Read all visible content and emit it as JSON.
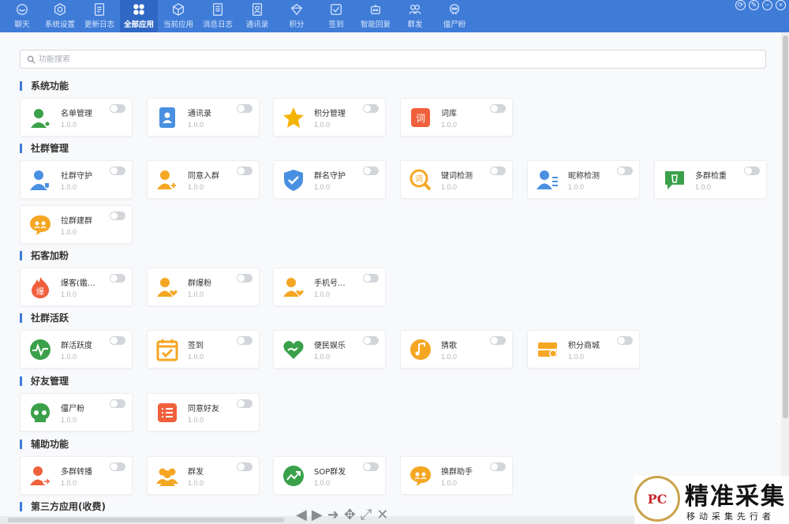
{
  "nav": {
    "tabs": [
      {
        "label": "聊天",
        "icon": "chat-icon"
      },
      {
        "label": "系统设置",
        "icon": "settings-icon"
      },
      {
        "label": "更新日志",
        "icon": "update-log-icon"
      },
      {
        "label": "全部应用",
        "icon": "all-apps-icon",
        "active": true
      },
      {
        "label": "当前应用",
        "icon": "current-apps-icon"
      },
      {
        "label": "消息日志",
        "icon": "message-log-icon"
      },
      {
        "label": "通讯录",
        "icon": "contacts-icon"
      },
      {
        "label": "积分",
        "icon": "points-icon"
      },
      {
        "label": "签到",
        "icon": "checkin-icon"
      },
      {
        "label": "智能回复",
        "icon": "robot-icon"
      },
      {
        "label": "群发",
        "icon": "broadcast-icon"
      },
      {
        "label": "僵尸粉",
        "icon": "zombie-icon"
      }
    ]
  },
  "search": {
    "placeholder": "功能搜索"
  },
  "sections": [
    {
      "title": "系统功能",
      "apps": [
        {
          "name": "名单管理",
          "version": "1.0.0",
          "icon": "user-list-icon",
          "color": "#3aa14a"
        },
        {
          "name": "通讯录",
          "version": "1.0.0",
          "icon": "contacts-book-icon",
          "color": "#4a90e2"
        },
        {
          "name": "积分管理",
          "version": "1.0.0",
          "icon": "star-icon",
          "color": "#f5b300"
        },
        {
          "name": "词库",
          "version": "1.0.0",
          "icon": "dictionary-icon",
          "color": "#f0603c"
        }
      ]
    },
    {
      "title": "社群管理",
      "apps": [
        {
          "name": "社群守护",
          "version": "1.0.0",
          "icon": "user-shield-icon",
          "color": "#4a90e2"
        },
        {
          "name": "同意入群",
          "version": "1.0.0",
          "icon": "group-add-icon",
          "color": "#f5a623"
        },
        {
          "name": "群名守护",
          "version": "1.0.0",
          "icon": "shield-icon",
          "color": "#4a90e2"
        },
        {
          "name": "键词检测",
          "version": "1.0.0",
          "icon": "keyword-search-icon",
          "color": "#f5a623"
        },
        {
          "name": "昵称检测",
          "version": "1.0.0",
          "icon": "user-list-check-icon",
          "color": "#4a90e2"
        },
        {
          "name": "多群检重",
          "version": "1.0.0",
          "icon": "trash-chat-icon",
          "color": "#3aa14a"
        },
        {
          "name": "拉群建群",
          "version": "1.0.0",
          "icon": "group-chat-icon",
          "color": "#f5a623"
        }
      ]
    },
    {
      "title": "拓客加粉",
      "apps": [
        {
          "name": "爆客(鑑...",
          "version": "1.0.0",
          "icon": "fire-icon",
          "color": "#f0603c"
        },
        {
          "name": "群爆粉",
          "version": "1.0.0",
          "icon": "user-heart-icon",
          "color": "#f5a623"
        },
        {
          "name": "手机号...",
          "version": "1.0.0",
          "icon": "user-heart-icon",
          "color": "#f5a623"
        }
      ]
    },
    {
      "title": "社群活跃",
      "apps": [
        {
          "name": "群活跃度",
          "version": "1.0.0",
          "icon": "activity-icon",
          "color": "#3aa14a"
        },
        {
          "name": "签到",
          "version": "1.0.0",
          "icon": "calendar-check-icon",
          "color": "#f5a623"
        },
        {
          "name": "便民娱乐",
          "version": "1.0.0",
          "icon": "heart-hand-icon",
          "color": "#3aa14a"
        },
        {
          "name": "猜歌",
          "version": "1.0.0",
          "icon": "music-icon",
          "color": "#f5a623"
        },
        {
          "name": "积分商城",
          "version": "1.0.0",
          "icon": "coins-icon",
          "color": "#f5a623"
        }
      ]
    },
    {
      "title": "好友管理",
      "apps": [
        {
          "name": "僵尸粉",
          "version": "1.0.0",
          "icon": "skull-icon",
          "color": "#3aa14a"
        },
        {
          "name": "同意好友",
          "version": "1.0.0",
          "icon": "checklist-icon",
          "color": "#f0603c"
        }
      ]
    },
    {
      "title": "辅助功能",
      "apps": [
        {
          "name": "多群转播",
          "version": "1.0.0",
          "icon": "user-share-icon",
          "color": "#f0603c"
        },
        {
          "name": "群发",
          "version": "1.0.0",
          "icon": "group-users-icon",
          "color": "#f5a623"
        },
        {
          "name": "SOP群发",
          "version": "1.0.0",
          "icon": "trend-up-icon",
          "color": "#3aa14a"
        },
        {
          "name": "换群助手",
          "version": "1.0.0",
          "icon": "group-chat-icon",
          "color": "#f5a623"
        }
      ]
    },
    {
      "title": "第三方应用(收费)",
      "apps": []
    }
  ],
  "watermark": {
    "big": "精准采集",
    "small": "移动采集先行者",
    "badge": "PC"
  }
}
